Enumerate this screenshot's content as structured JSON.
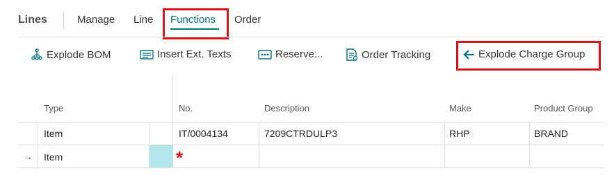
{
  "tabs": {
    "title": "Lines",
    "items": [
      "Manage",
      "Line",
      "Functions",
      "Order"
    ],
    "active": "Functions"
  },
  "actions": [
    {
      "label": "Explode BOM",
      "icon": "explode-bom-icon"
    },
    {
      "label": "Insert Ext. Texts",
      "icon": "insert-text-icon"
    },
    {
      "label": "Reserve...",
      "icon": "reserve-icon"
    },
    {
      "label": "Order Tracking",
      "icon": "order-tracking-icon"
    },
    {
      "label": "Explode Charge Group",
      "icon": "arrow-left-icon"
    }
  ],
  "table": {
    "columns": [
      "Type",
      "No.",
      "Description",
      "Make",
      "Product Group"
    ],
    "rows": [
      {
        "type": "Item",
        "no": "IT/0004134",
        "description": "7209CTRDULP3",
        "make": "RHP",
        "product_group": "BRAND"
      },
      {
        "type": "Item",
        "no": "",
        "description": "",
        "make": "",
        "product_group": "",
        "marker": "→",
        "required": "*"
      }
    ]
  },
  "colors": {
    "accent": "#00707a",
    "highlight": "#d8131a",
    "new_row_cell": "#b2e6ea",
    "required": "#d8131a"
  }
}
